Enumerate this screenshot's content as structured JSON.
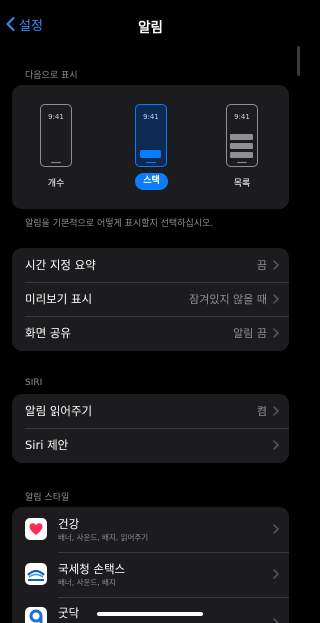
{
  "nav": {
    "back_label": "설정",
    "title": "알림"
  },
  "display_as": {
    "header": "다음으로 표시",
    "options": [
      {
        "label": "개수",
        "time": "9:41"
      },
      {
        "label": "스택",
        "time": "9:41",
        "selected": true
      },
      {
        "label": "목록",
        "time": "9:41"
      }
    ],
    "helper": "알림을 기본적으로 어떻게 표시할지 선택하십시오."
  },
  "general": {
    "rows": [
      {
        "label": "시간 지정 요약",
        "value": "끔"
      },
      {
        "label": "미리보기 표시",
        "value": "잠겨있지 않을 때"
      },
      {
        "label": "화면 공유",
        "value": "알림 끔"
      }
    ]
  },
  "siri": {
    "header": "SIRI",
    "rows": [
      {
        "label": "알림 읽어주기",
        "value": "켬"
      },
      {
        "label": "Siri 제안",
        "value": ""
      }
    ]
  },
  "app_styles": {
    "header": "알림 스타일",
    "apps": [
      {
        "name": "건강",
        "subtitle": "배너, 사운드, 배지, 읽어주기",
        "icon": "health-icon"
      },
      {
        "name": "국세청 손택스",
        "subtitle": "배너, 사운드, 배지",
        "icon": "hometax-icon"
      },
      {
        "name": "굿닥",
        "subtitle": "",
        "icon": "goodoc-icon"
      }
    ]
  },
  "colors": {
    "accent": "#0a7dfc",
    "background": "#000000",
    "card": "#1c1c1e",
    "secondary_text": "#8e8e93"
  }
}
